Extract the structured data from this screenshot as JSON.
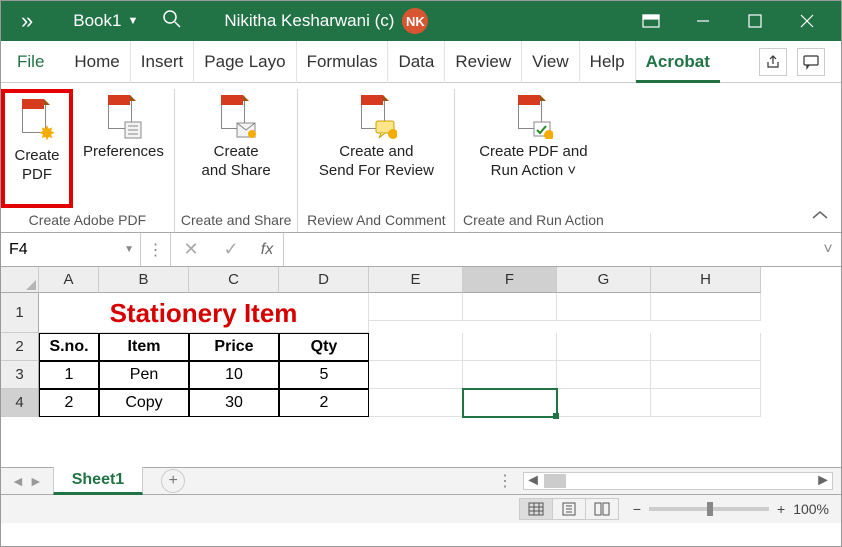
{
  "titlebar": {
    "more_glyph": "»",
    "book_name": "Book1",
    "user_name": "Nikitha Kesharwani (c)",
    "user_initials": "NK"
  },
  "ribbon": {
    "tabs": [
      "File",
      "Home",
      "Insert",
      "Page Layo",
      "Formulas",
      "Data",
      "Review",
      "View",
      "Help",
      "Acrobat"
    ],
    "active_tab": "Acrobat",
    "groups": [
      {
        "label": "Create Adobe PDF",
        "items": [
          {
            "name": "create-pdf",
            "label_line1": "Create",
            "label_line2": "PDF",
            "highlighted": true,
            "overlay": "star"
          },
          {
            "name": "preferences",
            "label_line1": "Preferences",
            "label_line2": "",
            "overlay": "prefs"
          }
        ]
      },
      {
        "label": "Create and Share",
        "items": [
          {
            "name": "create-and-share",
            "label_line1": "Create",
            "label_line2": "and Share",
            "overlay": "envelope"
          }
        ]
      },
      {
        "label": "Review And Comment",
        "items": [
          {
            "name": "create-and-send-review",
            "label_line1": "Create and",
            "label_line2": "Send For Review",
            "overlay": "comment"
          }
        ]
      },
      {
        "label": "Create and Run Action",
        "items": [
          {
            "name": "create-pdf-run-action",
            "label_line1": "Create PDF and",
            "label_line2": "Run Action ˅",
            "overlay": "check"
          }
        ]
      }
    ]
  },
  "formula_bar": {
    "name_box": "F4",
    "cancel": "✕",
    "confirm": "✓",
    "fx": "fx",
    "input_value": ""
  },
  "sheet": {
    "columns": [
      "A",
      "B",
      "C",
      "D",
      "E",
      "F",
      "G",
      "H"
    ],
    "active_col": "F",
    "active_row": 4,
    "rows": [
      1,
      2,
      3,
      4
    ],
    "title_cell": "Stationery Item",
    "headers": [
      "S.no.",
      "Item",
      "Price",
      "Qty"
    ],
    "data": [
      [
        "1",
        "Pen",
        "10",
        "5"
      ],
      [
        "2",
        "Copy",
        "30",
        "2"
      ]
    ],
    "tab_name": "Sheet1",
    "add_glyph": "⊕"
  },
  "statusbar": {
    "zoom_label": "100%",
    "minus": "−",
    "plus": "+"
  },
  "chart_data": {
    "type": "table",
    "title": "Stationery Item",
    "columns": [
      "S.no.",
      "Item",
      "Price",
      "Qty"
    ],
    "rows": [
      [
        1,
        "Pen",
        10,
        5
      ],
      [
        2,
        "Copy",
        30,
        2
      ]
    ]
  }
}
